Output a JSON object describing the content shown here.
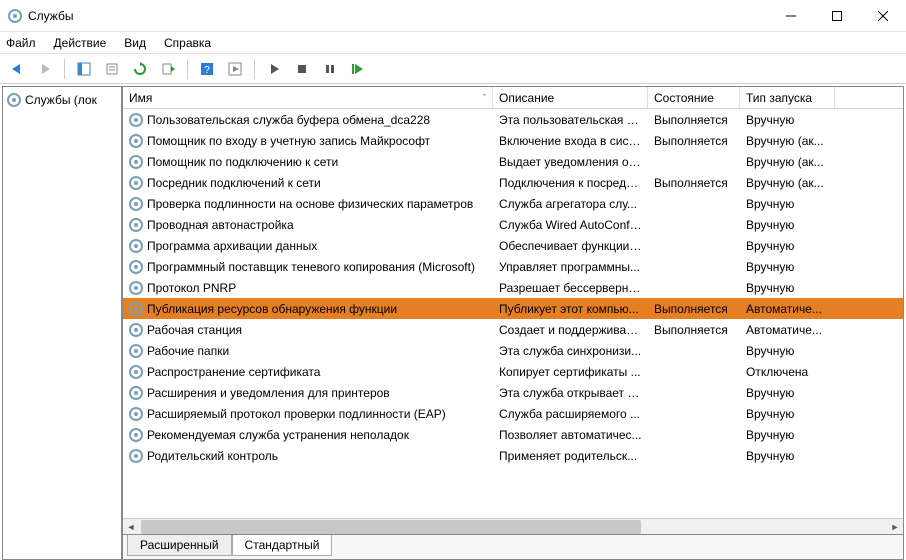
{
  "window": {
    "title": "Службы"
  },
  "menu": {
    "file": "Файл",
    "action": "Действие",
    "view": "Вид",
    "help": "Справка"
  },
  "sidebar": {
    "root": "Службы (лок"
  },
  "columns": {
    "name": "Имя",
    "desc": "Описание",
    "state": "Состояние",
    "start": "Тип запуска"
  },
  "tabs": {
    "extended": "Расширенный",
    "standard": "Стандартный"
  },
  "rows": [
    {
      "name": "Пользовательская служба буфера обмена_dca228",
      "desc": "Эта пользовательская с...",
      "state": "Выполняется",
      "start": "Вручную",
      "sel": false
    },
    {
      "name": "Помощник по входу в учетную запись Майкрософт",
      "desc": "Включение входа в сист...",
      "state": "Выполняется",
      "start": "Вручную (ак...",
      "sel": false
    },
    {
      "name": "Помощник по подключению к сети",
      "desc": "Выдает уведомления о с...",
      "state": "",
      "start": "Вручную (ак...",
      "sel": false
    },
    {
      "name": "Посредник подключений к сети",
      "desc": "Подключения к посредн...",
      "state": "Выполняется",
      "start": "Вручную (ак...",
      "sel": false
    },
    {
      "name": "Проверка подлинности на основе физических параметров",
      "desc": "Служба агрегатора слу...",
      "state": "",
      "start": "Вручную",
      "sel": false
    },
    {
      "name": "Проводная автонастройка",
      "desc": "Служба Wired AutoConfi...",
      "state": "",
      "start": "Вручную",
      "sel": false
    },
    {
      "name": "Программа архивации данных",
      "desc": "Обеспечивает функции ...",
      "state": "",
      "start": "Вручную",
      "sel": false
    },
    {
      "name": "Программный поставщик теневого копирования (Microsoft)",
      "desc": "Управляет программны...",
      "state": "",
      "start": "Вручную",
      "sel": false
    },
    {
      "name": "Протокол PNRP",
      "desc": "Разрешает бессерверно...",
      "state": "",
      "start": "Вручную",
      "sel": false
    },
    {
      "name": "Публикация ресурсов обнаружения функции",
      "desc": "Публикует этот компью...",
      "state": "Выполняется",
      "start": "Автоматиче...",
      "sel": true
    },
    {
      "name": "Рабочая станция",
      "desc": "Создает и поддерживает ...",
      "state": "Выполняется",
      "start": "Автоматиче...",
      "sel": false
    },
    {
      "name": "Рабочие папки",
      "desc": "Эта служба синхронизи...",
      "state": "",
      "start": "Вручную",
      "sel": false
    },
    {
      "name": "Распространение сертификата",
      "desc": "Копирует сертификаты ...",
      "state": "",
      "start": "Отключена",
      "sel": false
    },
    {
      "name": "Расширения и уведомления для принтеров",
      "desc": "Эта служба открывает п...",
      "state": "",
      "start": "Вручную",
      "sel": false
    },
    {
      "name": "Расширяемый протокол проверки подлинности (EAP)",
      "desc": "Служба расширяемого ...",
      "state": "",
      "start": "Вручную",
      "sel": false
    },
    {
      "name": "Рекомендуемая служба устранения неполадок",
      "desc": "Позволяет автоматичес...",
      "state": "",
      "start": "Вручную",
      "sel": false
    },
    {
      "name": "Родительский контроль",
      "desc": "Применяет родительск...",
      "state": "",
      "start": "Вручную",
      "sel": false
    }
  ]
}
